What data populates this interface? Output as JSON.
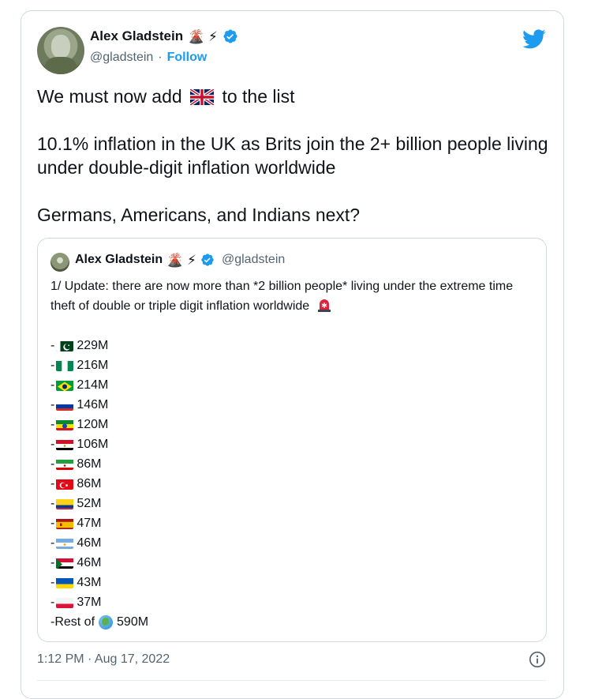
{
  "author": {
    "name": "Alex Gladstein",
    "emojis": "🌋 ⚡",
    "handle": "@gladstein",
    "separator": "·",
    "follow_label": "Follow"
  },
  "tweet": {
    "line1_before": "We must now add",
    "line1_after": "to the list",
    "line2": "10.1% inflation in the UK as Brits join the 2+ billion people living under double-digit inflation worldwide",
    "line3": "Germans, Americans, and Indians next?"
  },
  "quoted": {
    "name": "Alex Gladstein",
    "emojis": "🌋 ⚡",
    "handle": "@gladstein",
    "text": "1/ Update: there are now more than *2 billion people* living under the extreme time theft of double or triple digit inflation worldwide",
    "rows": [
      {
        "flag": "pakistan",
        "value": "229M"
      },
      {
        "flag": "nigeria",
        "value": "216M"
      },
      {
        "flag": "brazil",
        "value": "214M"
      },
      {
        "flag": "russia",
        "value": "146M"
      },
      {
        "flag": "ethiopia",
        "value": "120M"
      },
      {
        "flag": "egypt",
        "value": "106M"
      },
      {
        "flag": "iran",
        "value": "86M"
      },
      {
        "flag": "turkey",
        "value": "86M"
      },
      {
        "flag": "colombia",
        "value": "52M"
      },
      {
        "flag": "spain",
        "value": "47M"
      },
      {
        "flag": "argentina",
        "value": "46M"
      },
      {
        "flag": "sudan",
        "value": "46M"
      },
      {
        "flag": "ukraine",
        "value": "43M"
      },
      {
        "flag": "poland",
        "value": "37M"
      }
    ],
    "rest_before": "-Rest of",
    "rest_value": "590M"
  },
  "footer": {
    "timestamp": "1:12 PM · Aug 17, 2022"
  },
  "colors": {
    "accent": "#1d9bf0",
    "secondary_text": "#536471",
    "border": "#cfd9de"
  }
}
